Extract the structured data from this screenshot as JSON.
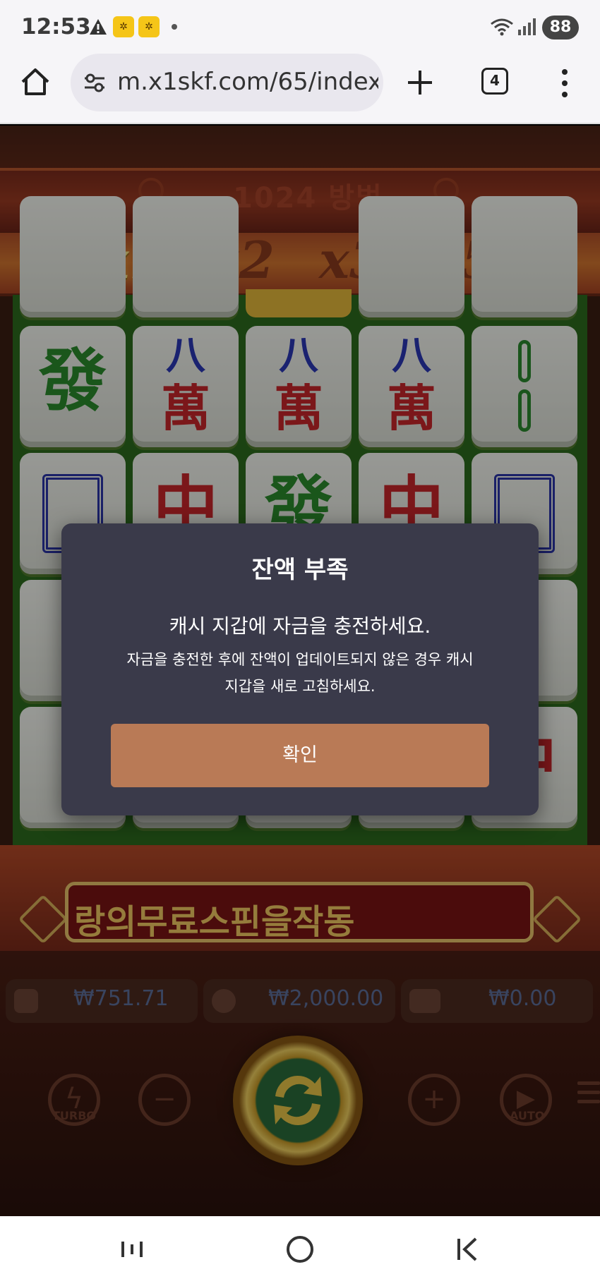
{
  "status_bar": {
    "time": "12:53",
    "battery": "88",
    "icons": [
      "warning-icon",
      "app-notification-icon",
      "app-notification-icon",
      "dot-icon",
      "wifi-icon",
      "signal-icon"
    ]
  },
  "browser": {
    "url": "m.x1skf.com/65/index.",
    "tab_count": "4",
    "icons": [
      "home-icon",
      "site-settings-icon",
      "new-tab-plus-icon",
      "menu-kebab-icon"
    ]
  },
  "game": {
    "ways_label": "1024 방법",
    "multipliers": [
      "x1",
      "x2",
      "x3",
      "x5"
    ],
    "active_multiplier": "x1",
    "tiles": {
      "green_dragon": "發",
      "eight": "八",
      "wan": "萬",
      "red_dragon": "中"
    },
    "marquee": "랑의무료스핀을작동",
    "balance": "₩751.71",
    "bet": "₩2,000.00",
    "win": "₩0.00",
    "controls": {
      "turbo_label": "TURBO",
      "auto_label": "AUTO",
      "minus": "−",
      "plus": "+"
    }
  },
  "modal": {
    "title": "잔액 부족",
    "main": "캐시 지갑에 자금을 충전하세요.",
    "sub_line1": "자금을 충전한 후에 잔액이 업데이트되지 않은 경우 캐시",
    "sub_line2": "지갑을 새로 고침하세요.",
    "confirm": "확인"
  },
  "colors": {
    "modal_bg": "#3a3a4a",
    "confirm_bg": "#b97a56",
    "active_multiplier": "#f2e48a"
  }
}
